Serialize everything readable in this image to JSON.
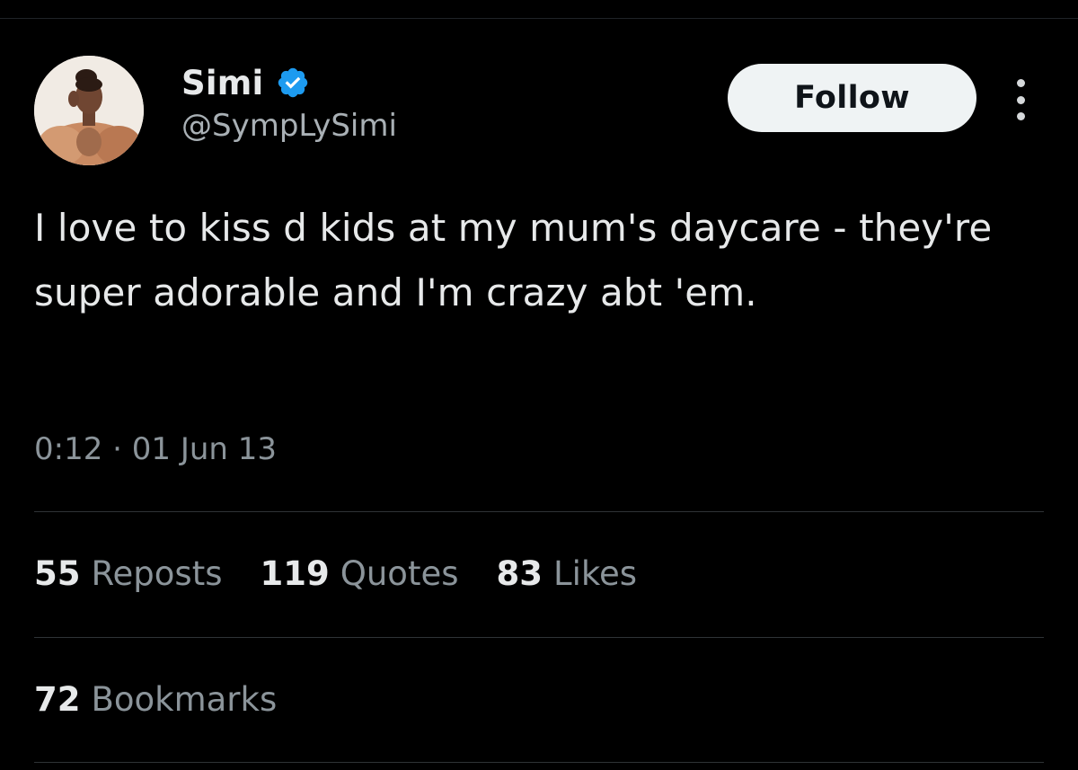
{
  "author": {
    "display_name": "Simi",
    "handle": "@SympLySimi",
    "verified": true,
    "avatar_icon": "profile-photo"
  },
  "follow_button": {
    "label": "Follow"
  },
  "tweet": {
    "text": "I love to kiss d kids at my mum's daycare - they're super adorable and I'm crazy abt 'em.",
    "timestamp": "0:12 · 01 Jun 13"
  },
  "stats": {
    "reposts": {
      "count": "55",
      "label": "Reposts"
    },
    "quotes": {
      "count": "119",
      "label": "Quotes"
    },
    "likes": {
      "count": "83",
      "label": "Likes"
    },
    "bookmarks": {
      "count": "72",
      "label": "Bookmarks"
    }
  },
  "colors": {
    "background": "#000000",
    "text_primary": "#e7e9ea",
    "text_secondary": "#8b949a",
    "verified_blue": "#1d9bf0",
    "follow_bg": "#eff3f4"
  }
}
